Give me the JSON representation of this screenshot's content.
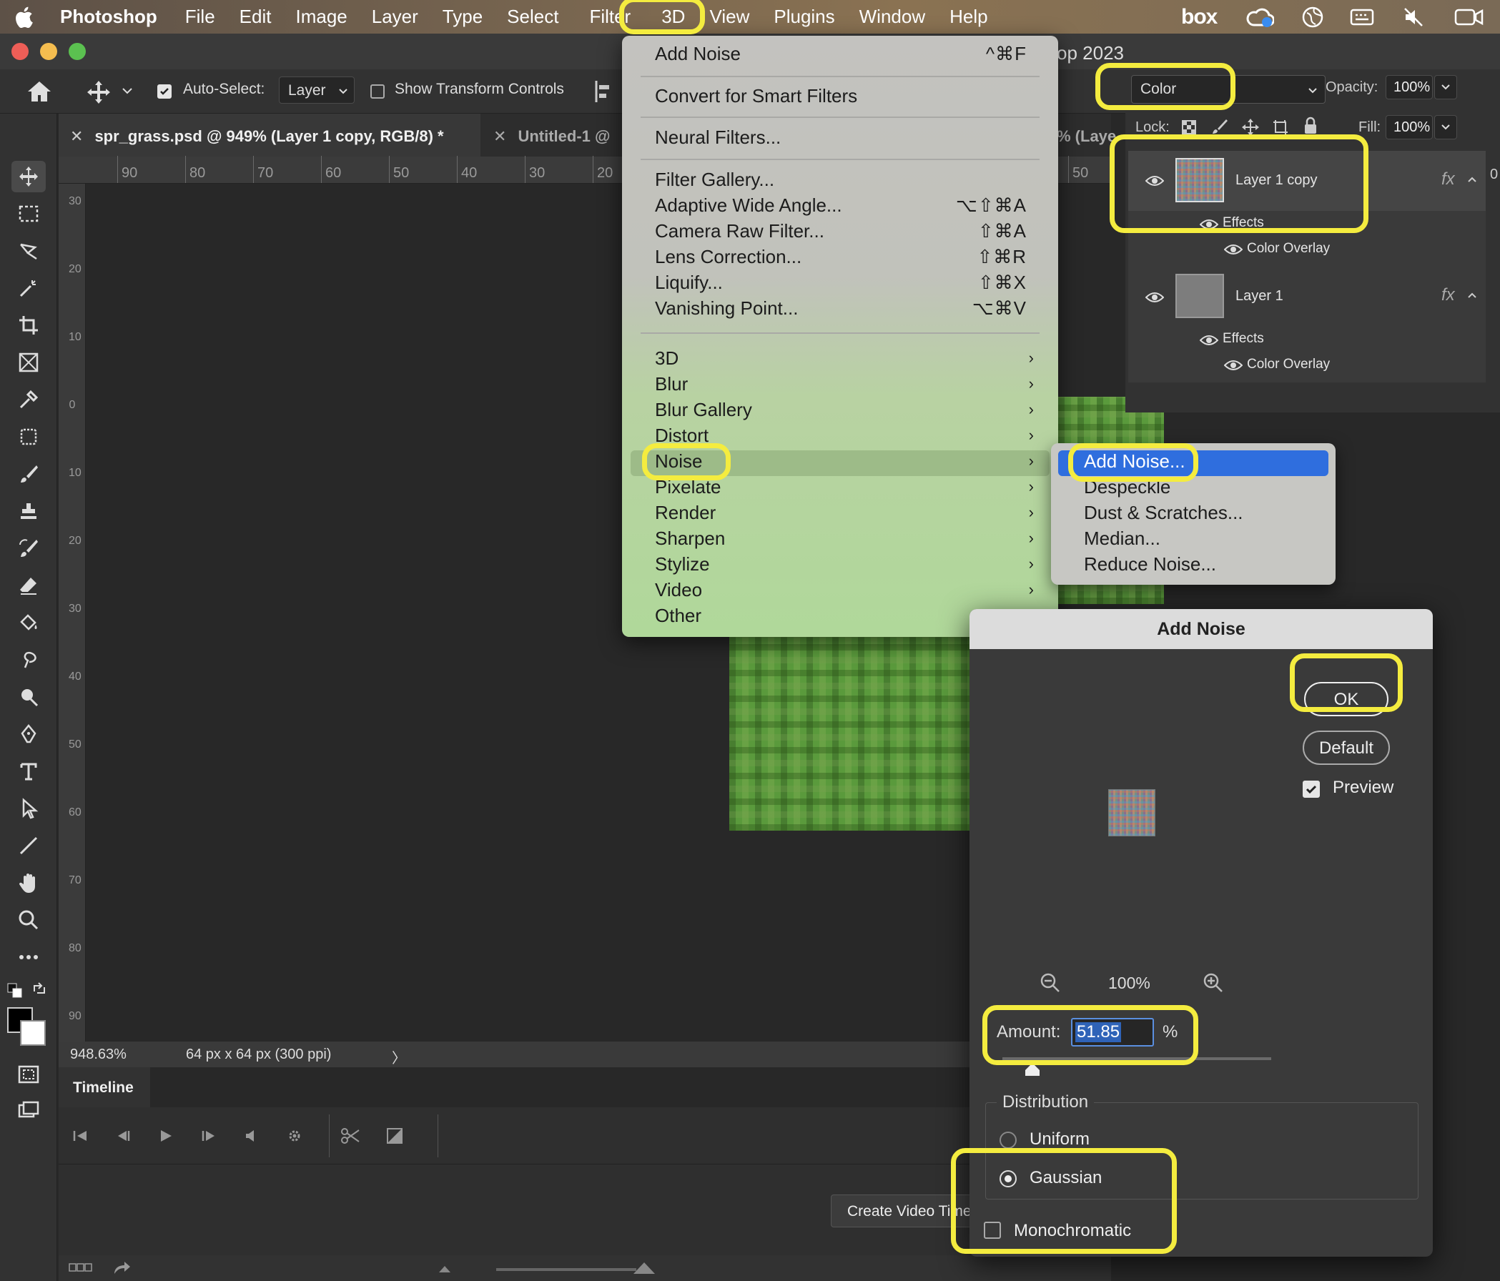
{
  "menubar": {
    "app": "Photoshop",
    "items": [
      "File",
      "Edit",
      "Image",
      "Layer",
      "Type",
      "Select",
      "Filter",
      "3D",
      "View",
      "Plugins",
      "Window",
      "Help"
    ],
    "box_label": "box"
  },
  "window": {
    "title_fragment": "op 2023"
  },
  "options": {
    "auto_select_label": "Auto-Select:",
    "auto_select_value": "Layer",
    "show_transform_label": "Show Transform Controls"
  },
  "tabs": [
    {
      "label": "spr_grass.psd @ 949% (Layer 1 copy, RGB/8) *",
      "active": true
    },
    {
      "label": "Untitled-1 @",
      "active": false
    }
  ],
  "tab_fragment": "% (Laye",
  "ruler": {
    "labels": [
      "90",
      "80",
      "70",
      "60",
      "50",
      "40",
      "30",
      "20"
    ],
    "right_label": "50",
    "vertical": [
      "30",
      "20",
      "10",
      "0",
      "10",
      "20",
      "30",
      "40",
      "50",
      "60",
      "70",
      "80",
      "90"
    ]
  },
  "status": {
    "zoom": "948.63%",
    "doc_size": "64 px x 64 px (300 ppi)",
    "arrow": "〉"
  },
  "timeline": {
    "tab": "Timeline",
    "create_video": "Create Video Timeline"
  },
  "layers_panel": {
    "blend_mode": "Color",
    "opacity_label": "Opacity:",
    "opacity_value": "100%",
    "lock_label": "Lock:",
    "fill_label": "Fill:",
    "fill_value": "100%",
    "edge_value": "0",
    "layers": [
      {
        "name": "Layer 1 copy",
        "effects_label": "Effects",
        "effect": "Color Overlay",
        "fx": "fx"
      },
      {
        "name": "Layer 1",
        "effects_label": "Effects",
        "effect": "Color Overlay",
        "fx": "fx"
      }
    ]
  },
  "filter_menu": {
    "top": [
      {
        "label": "Add Noise",
        "shortcut": "^⌘F"
      },
      {
        "label": "Convert for Smart Filters",
        "shortcut": ""
      },
      {
        "label": "Neural Filters...",
        "shortcut": ""
      }
    ],
    "middle": [
      {
        "label": "Filter Gallery...",
        "shortcut": ""
      },
      {
        "label": "Adaptive Wide Angle...",
        "shortcut": "⌥⇧⌘A"
      },
      {
        "label": "Camera Raw Filter...",
        "shortcut": "⇧⌘A"
      },
      {
        "label": "Lens Correction...",
        "shortcut": "⇧⌘R"
      },
      {
        "label": "Liquify...",
        "shortcut": "⇧⌘X"
      },
      {
        "label": "Vanishing Point...",
        "shortcut": "⌥⌘V"
      }
    ],
    "groups": [
      "3D",
      "Blur",
      "Blur Gallery",
      "Distort",
      "Noise",
      "Pixelate",
      "Render",
      "Sharpen",
      "Stylize",
      "Video",
      "Other"
    ],
    "submenu_arrow": "›"
  },
  "noise_submenu": [
    "Add Noise...",
    "Despeckle",
    "Dust & Scratches...",
    "Median...",
    "Reduce Noise..."
  ],
  "dialog": {
    "title": "Add Noise",
    "ok": "OK",
    "default": "Default",
    "preview_label": "Preview",
    "zoom": "100%",
    "amount_label": "Amount:",
    "amount_value": "51.85",
    "percent": "%",
    "distribution_label": "Distribution",
    "uniform": "Uniform",
    "gaussian": "Gaussian",
    "monochromatic": "Monochromatic",
    "selected_distribution": "Gaussian",
    "preview_checked": true,
    "monochromatic_checked": false
  },
  "colors": {
    "annotation": "#f4ec3f",
    "menu_highlight": "#2f6ede",
    "noise_row": "#9dbb88"
  }
}
